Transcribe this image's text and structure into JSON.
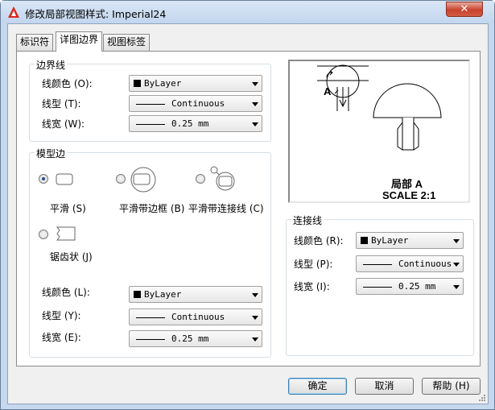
{
  "window": {
    "title": "修改局部视图样式: Imperial24",
    "close_label": "✕"
  },
  "tabs": [
    {
      "label": "标识符",
      "active": false
    },
    {
      "label": "详图边界",
      "active": true
    },
    {
      "label": "视图标签",
      "active": false
    }
  ],
  "boundary": {
    "legend": "边界线",
    "color_label": "线颜色 (O):",
    "color_value": "ByLayer",
    "linetype_label": "线型 (T):",
    "linetype_value": "Continuous",
    "lineweight_label": "线宽 (W):",
    "lineweight_value": "0.25 mm"
  },
  "model_edge": {
    "legend": "模型边",
    "options": [
      {
        "label": "平滑 (S)",
        "checked": true
      },
      {
        "label": "平滑带边框 (B)",
        "checked": false
      },
      {
        "label": "平滑带连接线 (C)",
        "checked": false
      },
      {
        "label": "锯齿状 (J)",
        "checked": false
      }
    ],
    "color_label": "线颜色 (L):",
    "color_value": "ByLayer",
    "linetype_label": "线型 (Y):",
    "linetype_value": "Continuous",
    "lineweight_label": "线宽 (E):",
    "lineweight_value": "0.25 mm"
  },
  "preview": {
    "marker": "A",
    "caption_line1": "局部  A",
    "caption_line2": "SCALE 2:1"
  },
  "connection": {
    "legend": "连接线",
    "color_label": "线颜色 (R):",
    "color_value": "ByLayer",
    "linetype_label": "线型 (P):",
    "linetype_value": "Continuous",
    "lineweight_label": "线宽 (I):",
    "lineweight_value": "0.25 mm"
  },
  "buttons": {
    "ok": "确定",
    "cancel": "取消",
    "help": "帮助 (H)"
  },
  "colors": {
    "accent": "#3c7fb1",
    "swatch": "#000000",
    "app_icon": "#d9261c"
  },
  "icons": [
    "autocad-logo-icon",
    "close-icon",
    "dropdown-arrow-icon",
    "resize-grip-icon"
  ]
}
